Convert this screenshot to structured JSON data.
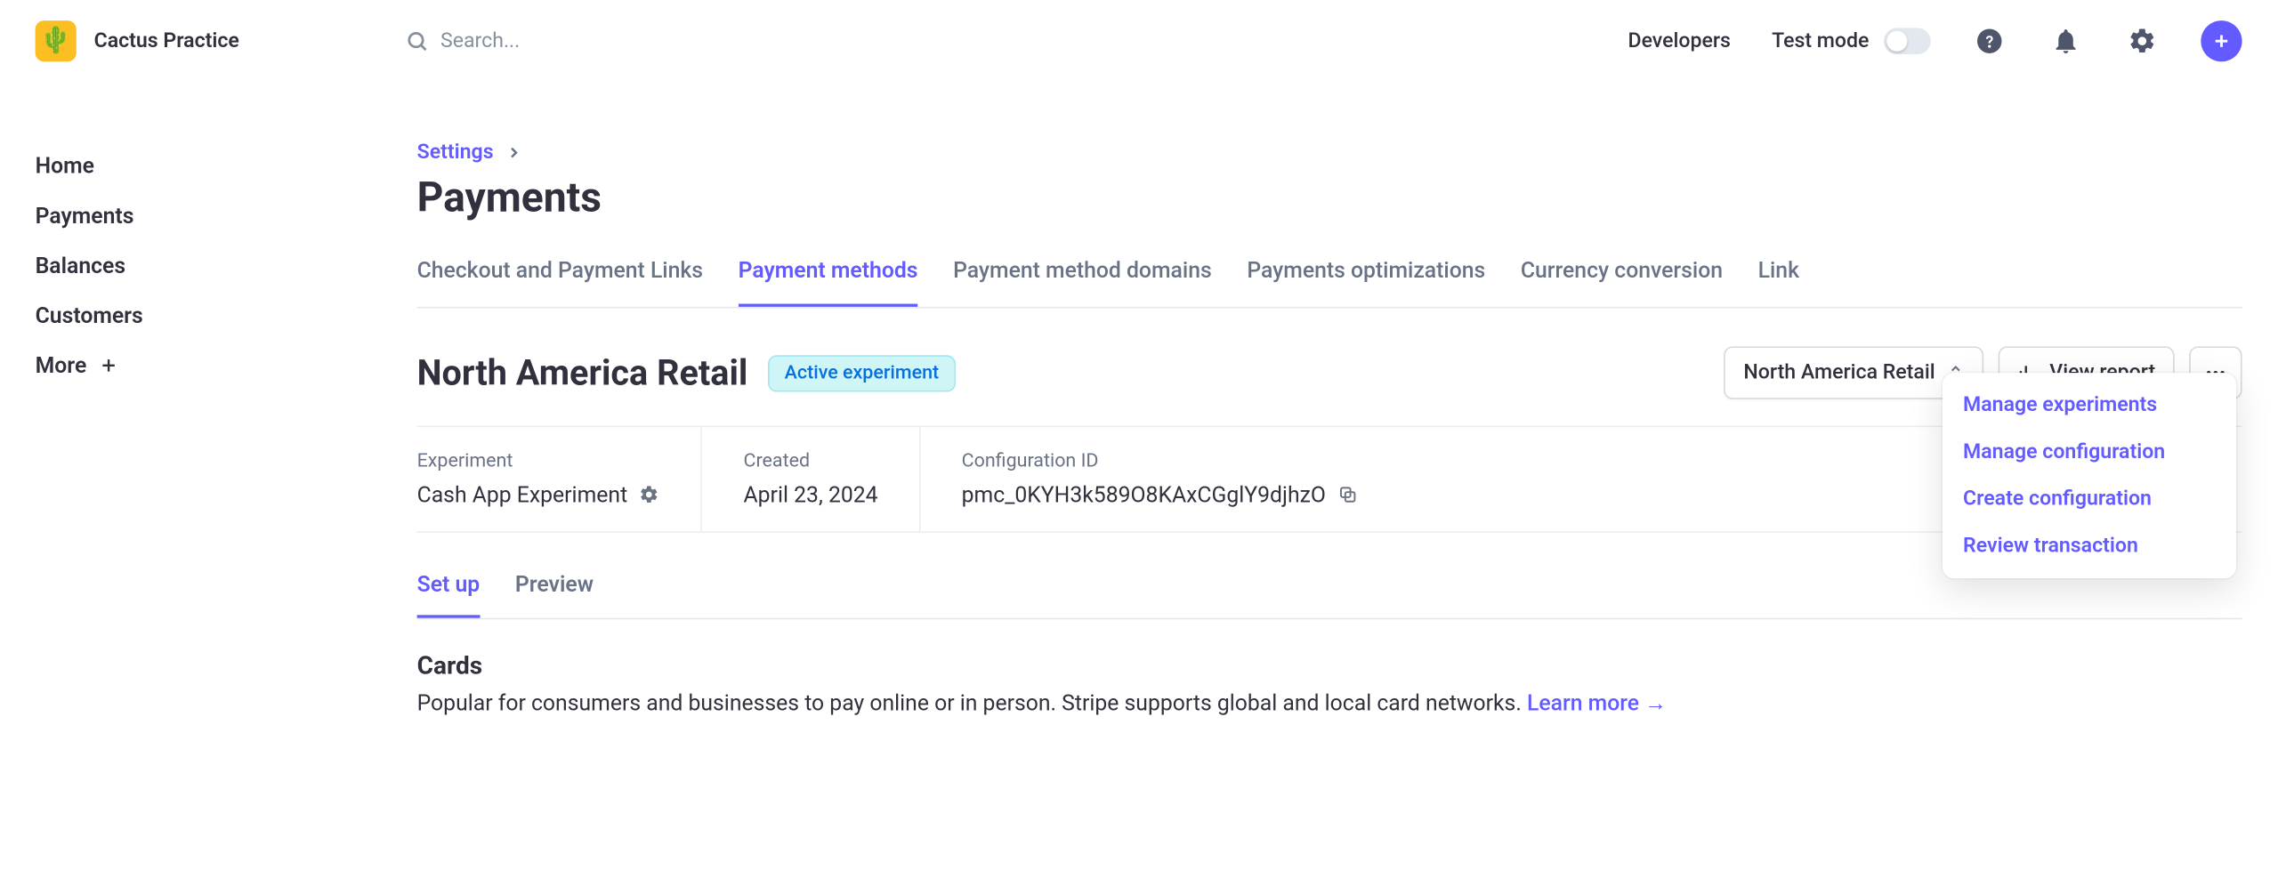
{
  "brand": {
    "name": "Cactus Practice",
    "logo_emoji": "🌵"
  },
  "search": {
    "placeholder": "Search..."
  },
  "top_links": {
    "developers": "Developers",
    "test_mode": "Test mode"
  },
  "sidebar": {
    "items": [
      {
        "label": "Home"
      },
      {
        "label": "Payments"
      },
      {
        "label": "Balances"
      },
      {
        "label": "Customers"
      },
      {
        "label": "More"
      }
    ]
  },
  "breadcrumb": {
    "root": "Settings"
  },
  "page_title": "Payments",
  "tabs": [
    {
      "label": "Checkout and Payment Links",
      "active": false
    },
    {
      "label": "Payment methods",
      "active": true
    },
    {
      "label": "Payment method domains",
      "active": false
    },
    {
      "label": "Payments optimizations",
      "active": false
    },
    {
      "label": "Currency conversion",
      "active": false
    },
    {
      "label": "Link",
      "active": false
    }
  ],
  "section": {
    "title": "North America Retail",
    "badge": "Active experiment",
    "select_value": "North America Retail",
    "view_report": "View report"
  },
  "meta": {
    "experiment_label": "Experiment",
    "experiment_value": "Cash App Experiment",
    "created_label": "Created",
    "created_value": "April 23, 2024",
    "config_label": "Configuration ID",
    "config_value": "pmc_0KYH3k589O8KAxCGglY9djhzO"
  },
  "subtabs": [
    {
      "label": "Set up",
      "active": true
    },
    {
      "label": "Preview",
      "active": false
    }
  ],
  "content": {
    "heading": "Cards",
    "body": "Popular for consumers and businesses to pay online or in person. Stripe supports global and local card networks. ",
    "learn_more": "Learn more →"
  },
  "dropdown": [
    {
      "label": "Manage experiments"
    },
    {
      "label": "Manage configuration"
    },
    {
      "label": "Create configuration"
    },
    {
      "label": "Review transaction"
    }
  ]
}
